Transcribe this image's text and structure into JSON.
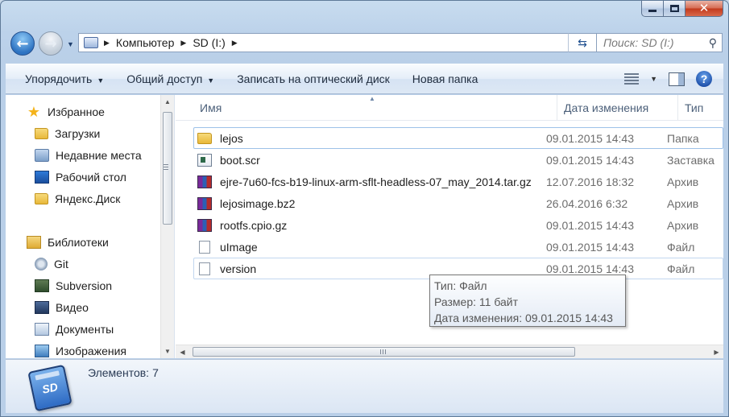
{
  "window": {
    "minimize_glyph": "minimize",
    "maximize_glyph": "maximize",
    "close_glyph": "✕"
  },
  "address": {
    "breadcrumbs": [
      "Компьютер",
      "SD (I:)"
    ],
    "search_placeholder": "Поиск: SD (I:)"
  },
  "toolbar": {
    "organize": "Упорядочить",
    "share": "Общий доступ",
    "burn": "Записать на оптический диск",
    "new_folder": "Новая папка"
  },
  "nav": {
    "favorites_title": "Избранное",
    "favorites": [
      "Загрузки",
      "Недавние места",
      "Рабочий стол",
      "Яндекс.Диск"
    ],
    "libraries_title": "Библиотеки",
    "libraries": [
      "Git",
      "Subversion",
      "Видео",
      "Документы",
      "Изображения"
    ]
  },
  "columns": {
    "name": "Имя",
    "date": "Дата изменения",
    "type": "Тип"
  },
  "files": [
    {
      "name": "lejos",
      "date": "09.01.2015 14:43",
      "type": "Папка",
      "icon": "folder-icon"
    },
    {
      "name": "boot.scr",
      "date": "09.01.2015 14:43",
      "type": "Заставка",
      "icon": "screensaver-icon"
    },
    {
      "name": "ejre-7u60-fcs-b19-linux-arm-sflt-headless-07_may_2014.tar.gz",
      "date": "12.07.2016 18:32",
      "type": "Архив",
      "icon": "archive-icon"
    },
    {
      "name": "lejosimage.bz2",
      "date": "26.04.2016 6:32",
      "type": "Архив",
      "icon": "archive-icon"
    },
    {
      "name": "rootfs.cpio.gz",
      "date": "09.01.2015 14:43",
      "type": "Архив",
      "icon": "archive-icon"
    },
    {
      "name": "uImage",
      "date": "09.01.2015 14:43",
      "type": "Файл",
      "icon": "file-icon"
    },
    {
      "name": "version",
      "date": "09.01.2015 14:43",
      "type": "Файл",
      "icon": "file-icon"
    }
  ],
  "tooltip": {
    "type": "Тип: Файл",
    "size": "Размер: 11 байт",
    "date": "Дата изменения: 09.01.2015 14:43"
  },
  "details": {
    "count_label": "Элементов:",
    "count_value": "7",
    "drive_badge": "SD"
  },
  "colors": {
    "accent": "#2d73c2",
    "selection_border": "#9dc1e8",
    "toolbar": "#dde8f5"
  }
}
